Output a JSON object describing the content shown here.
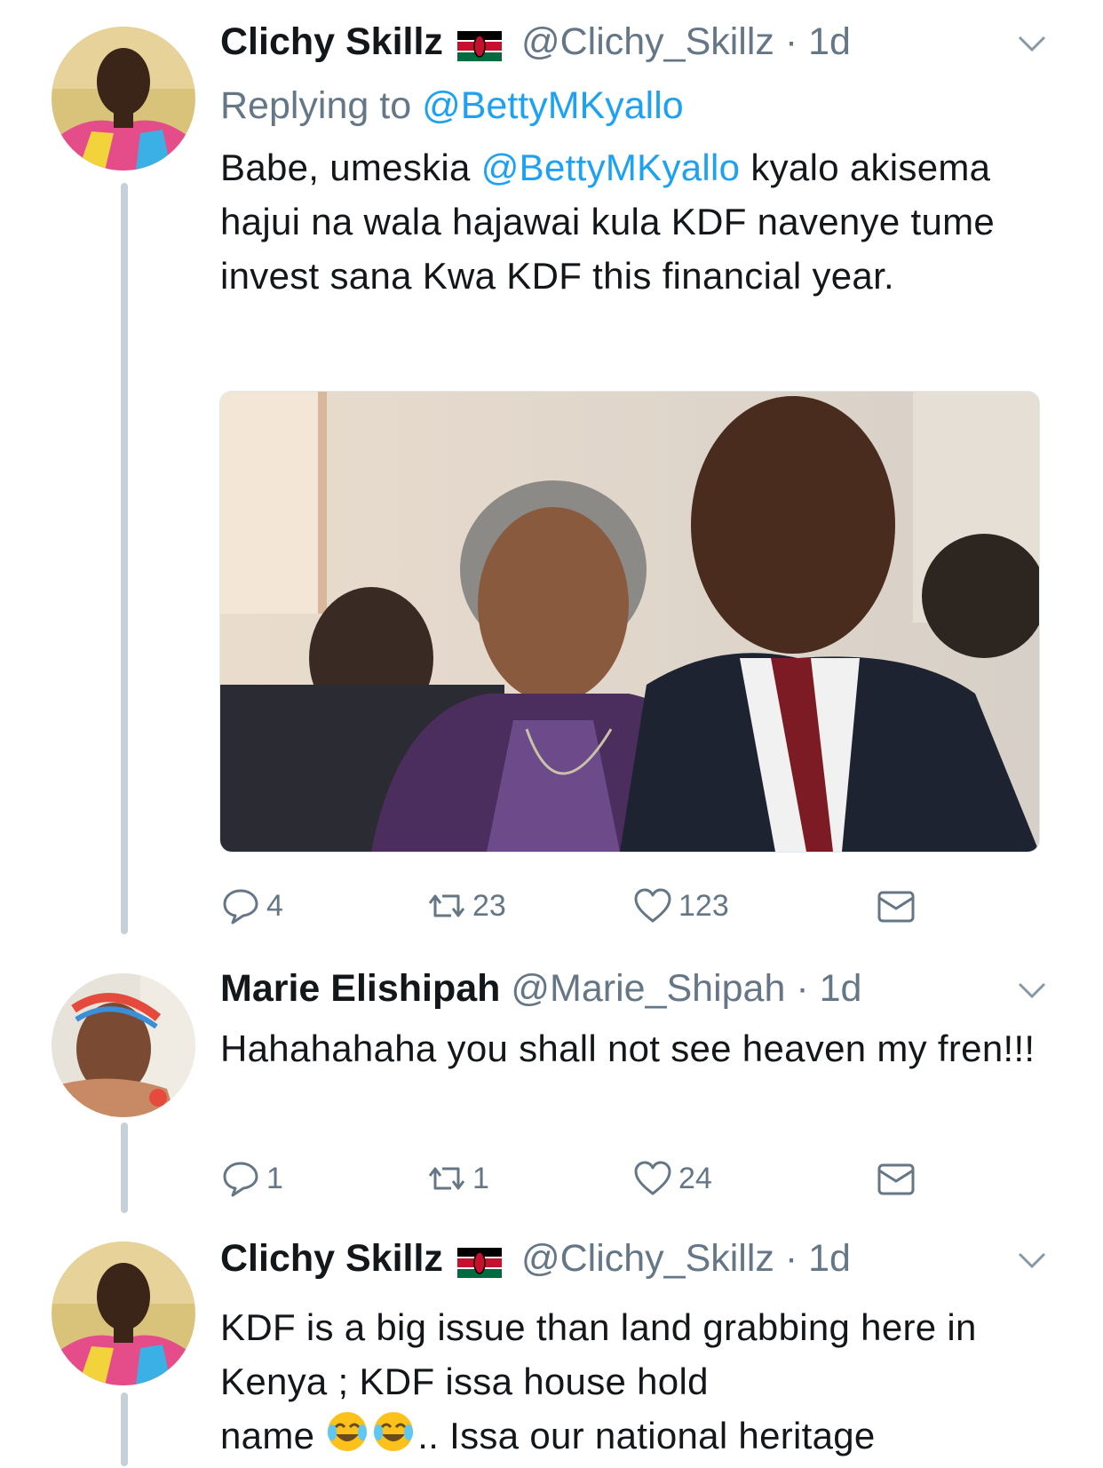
{
  "tweets": [
    {
      "name": "Clichy Skillz",
      "handle": "@Clichy_Skillz",
      "time": "1d",
      "replying_label": "Replying to",
      "replying_to": "@BettyMKyallo",
      "text_pre": "Babe,  umeskia",
      "mention": "@BettyMKyallo",
      "text_post": "kyalo akisema hajui na wala hajawai kula KDF navenye tume invest sana Kwa KDF this financial year.",
      "has_flag": true,
      "actions": {
        "replies": "4",
        "retweets": "23",
        "likes": "123"
      }
    },
    {
      "name": "Marie Elishipah",
      "handle": "@Marie_Shipah",
      "time": "1d",
      "text": "Hahahahaha you shall not see heaven my fren!!!",
      "has_flag": false,
      "actions": {
        "replies": "1",
        "retweets": "1",
        "likes": "24"
      }
    },
    {
      "name": "Clichy Skillz",
      "handle": "@Clichy_Skillz",
      "time": "1d",
      "text": "KDF is a big issue than land grabbing here in Kenya ; KDF issa house hold",
      "text_last_pre": "name",
      "text_last_post": ".. Issa our national heritage",
      "has_flag": true,
      "emoji": [
        "joy-emoji",
        "joy-emoji"
      ]
    }
  ],
  "separator": " · ",
  "icons": {
    "reply": "reply-icon",
    "retweet": "retweet-icon",
    "like": "heart-icon",
    "dm": "envelope-icon",
    "caret": "chevron-down-icon",
    "flag": "kenya-flag-icon"
  },
  "colors": {
    "link": "#1da1f2",
    "secondary": "#657786",
    "thread_line": "#c5d0d9"
  }
}
